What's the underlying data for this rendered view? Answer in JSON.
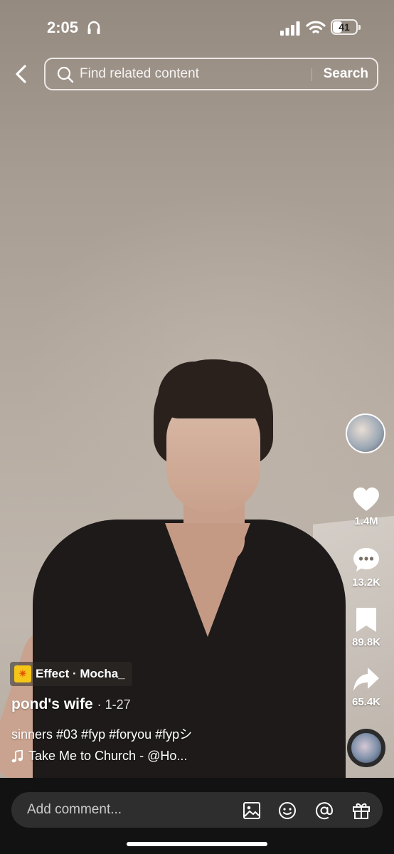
{
  "status_bar": {
    "time": "2:05",
    "battery": "41"
  },
  "search": {
    "placeholder": "Find related content",
    "button_label": "Search"
  },
  "rail": {
    "likes": "1.4M",
    "comments": "13.2K",
    "saves": "89.8K",
    "shares": "65.4K"
  },
  "post": {
    "effect_label": "Effect · Mocha_",
    "author": "pond's wife",
    "date": "· 1-27",
    "caption": "sinners #03 #fyp #foryou #fypシ",
    "music": "Take Me to Church - @Ho..."
  },
  "comment": {
    "placeholder": "Add comment..."
  },
  "icons": {
    "back": "chevron-left-icon",
    "search": "search-icon",
    "like": "heart-icon",
    "comment": "chat-bubble-icon",
    "save": "bookmark-icon",
    "share": "share-arrow-icon",
    "music": "music-note-icon",
    "image": "image-icon",
    "emoji": "emoji-icon",
    "mention": "at-icon",
    "gift": "gift-icon"
  },
  "colors": {
    "bottom_bar": "#121212",
    "comment_box": "#2e2e2e",
    "effect_icon": "#f5c518"
  }
}
